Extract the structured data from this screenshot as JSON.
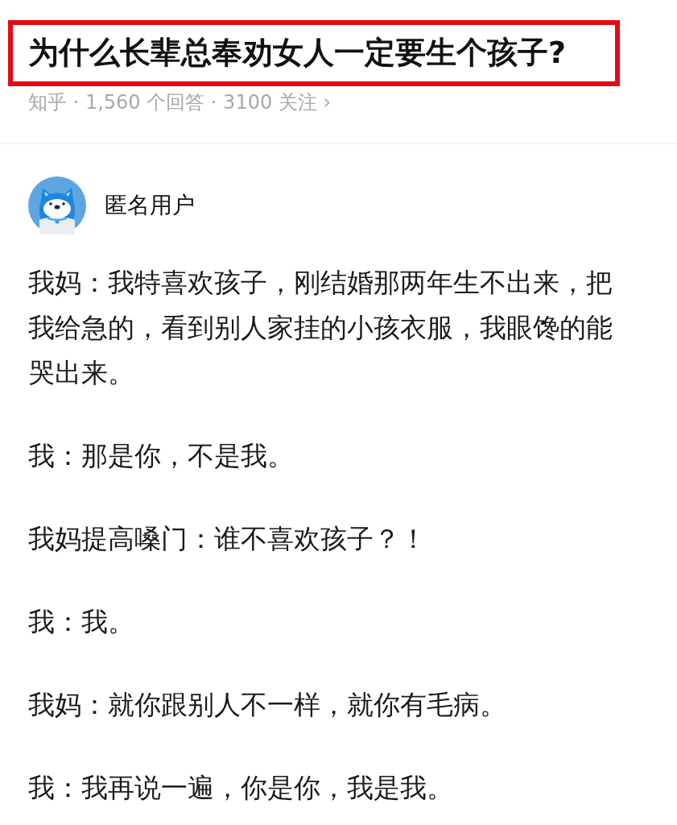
{
  "question": {
    "title": "为什么长辈总奉劝女人一定要生个孩子?",
    "meta": "知乎 · 1,560 个回答 · 3100 关注 ›",
    "highlighted": true
  },
  "answer": {
    "author": {
      "name": "匿名用户"
    },
    "paragraphs": [
      "我妈：我特喜欢孩子，刚结婚那两年生不出来，把我给急的，看到别人家挂的小孩衣服，我眼馋的能哭出来。",
      "我：那是你，不是我。",
      "我妈提高嗓门：谁不喜欢孩子？！",
      "我：我。",
      "我妈：就你跟别人不一样，就你有毛病。",
      "我：我再说一遍，你是你，我是我。"
    ]
  }
}
